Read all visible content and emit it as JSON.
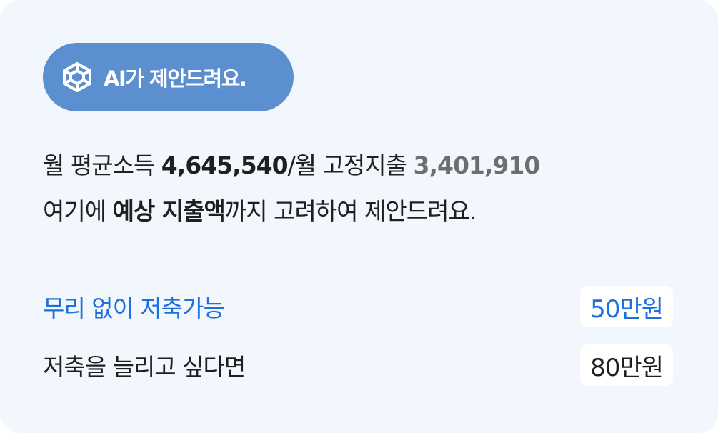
{
  "badge": {
    "icon": "cube-icon",
    "label": "AI가 제안드려요."
  },
  "summary": {
    "line1": {
      "income_label": "월 평균소득 ",
      "income_value": "4,645,540",
      "fixed_label": "/월 고정지출 ",
      "fixed_value": "3,401,910"
    },
    "line2": {
      "prefix": "여기에 ",
      "emphasis": "예상 지출액",
      "suffix": "까지 고려하여 제안드려요."
    }
  },
  "suggestions": [
    {
      "label": "무리 없이 저축가능",
      "amount": "50만원"
    },
    {
      "label": "저축을 늘리고 싶다면",
      "amount": "80만원"
    }
  ],
  "colors": {
    "card_background": "#f2f6fd",
    "badge_background": "#5b8fcf",
    "accent_blue": "#1f6fdc",
    "text_primary": "#1f1f1f",
    "text_muted": "#6e6e6e"
  }
}
